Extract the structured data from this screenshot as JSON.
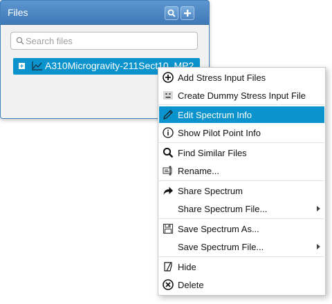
{
  "panel": {
    "title": "Files",
    "search_placeholder": "Search files",
    "file": {
      "name": "A310Microgravity-211Sect10_MP2"
    }
  },
  "menu": {
    "items": [
      {
        "label": "Add Stress Input Files",
        "icon": "plus-circle-icon"
      },
      {
        "label": "Create Dummy Stress Input File",
        "icon": "dummy-icon"
      },
      {
        "label": "Edit Spectrum Info",
        "icon": "pencil-icon",
        "highlighted": true
      },
      {
        "label": "Show Pilot Point Info",
        "icon": "info-icon"
      },
      {
        "label": "Find Similar Files",
        "icon": "search-icon"
      },
      {
        "label": "Rename...",
        "icon": "rename-icon"
      },
      {
        "label": "Share Spectrum",
        "icon": "share-arrow-icon"
      },
      {
        "label": "Share Spectrum File...",
        "icon": "",
        "submenu": true
      },
      {
        "label": "Save Spectrum As...",
        "icon": "save-icon"
      },
      {
        "label": "Save Spectrum File...",
        "icon": "",
        "submenu": true
      },
      {
        "label": "Hide",
        "icon": "hide-icon"
      },
      {
        "label": "Delete",
        "icon": "delete-circle-icon"
      }
    ]
  },
  "colors": {
    "header": "#4f8ac4",
    "selection": "#0a93cc"
  }
}
